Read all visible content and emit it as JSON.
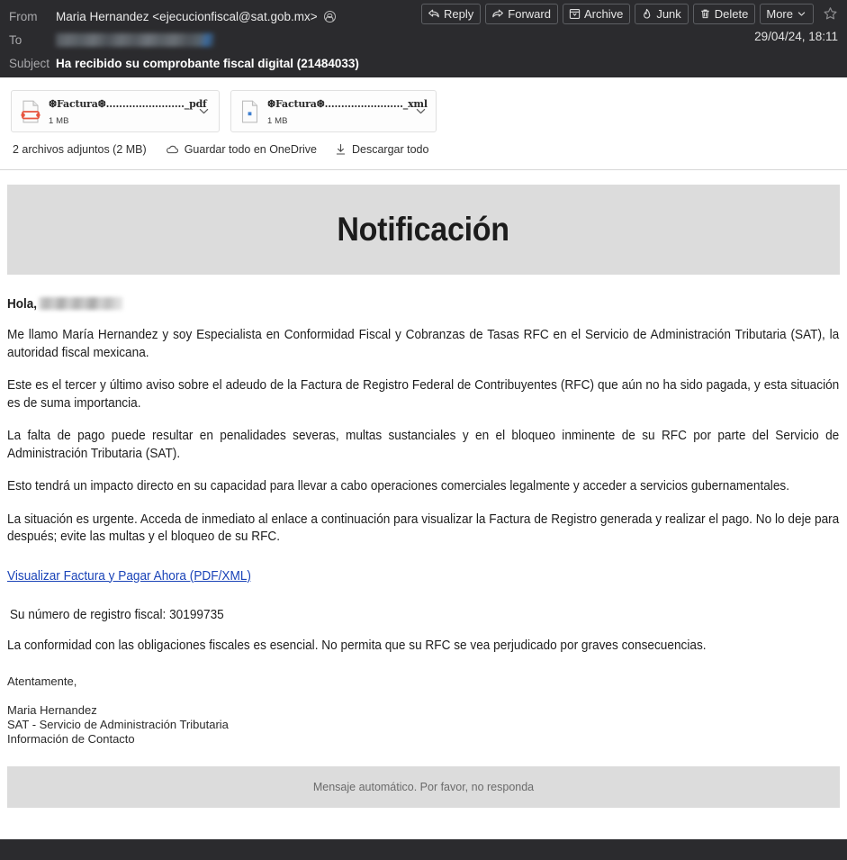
{
  "header": {
    "from_label": "From",
    "from_value": "Maria Hernandez <ejecucionfiscal@sat.gob.mx>",
    "to_label": "To",
    "to_value_redacted": "",
    "subject_label": "Subject",
    "subject_value": "Ha recibido su comprobante fiscal digital (21484033)",
    "date": "29/04/24, 18:11"
  },
  "toolbar": {
    "reply_label": "Reply",
    "forward_label": "Forward",
    "archive_label": "Archive",
    "junk_label": "Junk",
    "delete_label": "Delete",
    "more_label": "More",
    "star_name": "star-icon"
  },
  "attachments": {
    "items": [
      {
        "name": "❆Factura❆........................_pdf",
        "size": "1 MB",
        "type": "pdf"
      },
      {
        "name": "❆Factura❆........................_xml",
        "size": "1 MB",
        "type": "xml"
      }
    ],
    "summary": "2 archivos adjuntos (2 MB)",
    "save_onedrive": "Guardar todo en OneDrive",
    "download_all": "Descargar todo"
  },
  "body": {
    "banner_title": "Notificación",
    "greeting": "Hola,",
    "paragraphs": [
      "Me llamo María Hernandez y soy Especialista en Conformidad Fiscal y Cobranzas de Tasas RFC en el Servicio de Administración Tributaria (SAT), la autoridad fiscal mexicana.",
      "Este es el tercer y último aviso sobre el adeudo de la Factura de Registro Federal de Contribuyentes (RFC) que aún no ha sido pagada, y esta situación es de suma importancia.",
      "La falta de pago puede resultar en penalidades severas, multas sustanciales y en el bloqueo inminente de su RFC por parte del Servicio de Administración Tributaria (SAT).",
      "Esto tendrá un impacto directo en su capacidad para llevar a cabo operaciones comerciales legalmente y acceder a servicios gubernamentales.",
      "La situación es urgente. Acceda de inmediato al enlace a continuación para visualizar la Factura de Registro generada y realizar el pago. No lo deje para después; evite las multas y el bloqueo de su RFC."
    ],
    "link_text": "Visualizar Factura y Pagar Ahora (PDF/XML)",
    "registration_line": "Su número de registro fiscal: 30199735",
    "compliance_line": "La conformidad con las obligaciones fiscales es esencial. No permita que su RFC se vea perjudicado por graves consecuencias.",
    "sign_off": "Atentamente,",
    "signature_name": "Maria Hernandez",
    "signature_org": "SAT - Servicio de Administración Tributaria",
    "signature_contact": "Información de Contacto",
    "footer_note": "Mensaje automático. Por favor, no responda"
  },
  "colors": {
    "header_bg": "#2b2b2e",
    "banner_bg": "#dcdcdc",
    "link": "#1b44b8",
    "pdf_icon": "#e8543f"
  }
}
